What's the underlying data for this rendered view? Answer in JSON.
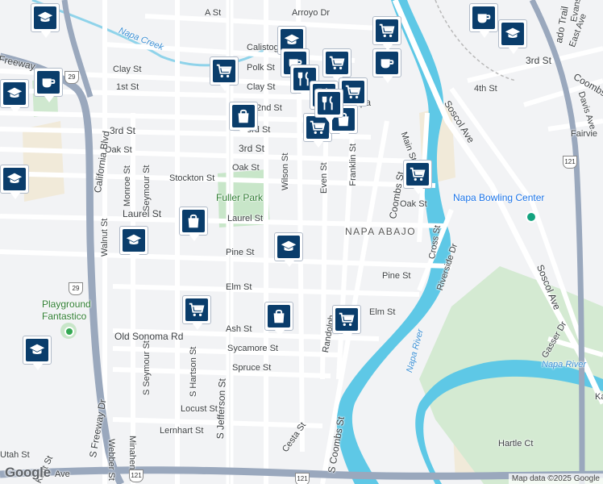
{
  "map": {
    "streets": {
      "arroyo": "Arroyo Dr",
      "a_st": "A St",
      "calistoga": "Calistoga",
      "clay_west": "Clay St",
      "clay_mid": "Clay St",
      "polk": "Polk St",
      "first": "1st St",
      "second": "2nd St",
      "third_west": "3rd St",
      "third_mid": "3rd St",
      "third_east": "3rd St",
      "oak_west": "Oak St",
      "oak_mid": "Oak St",
      "oak_east": "Oak St",
      "stockton": "Stockton St",
      "laurel_west": "Laurel St",
      "laurel_mid": "Laurel St",
      "pine_mid": "Pine St",
      "pine_east": "Pine St",
      "elm_mid": "Elm St",
      "elm_east": "Elm St",
      "ash": "Ash St",
      "sycamore": "Sycamore St",
      "spruce": "Spruce St",
      "locust": "Locust St",
      "lernhart": "Lernhart St",
      "old_sonoma": "Old Sonoma Rd",
      "main": "Main St",
      "franklin": "Franklin St",
      "wilson": "Wilson St",
      "even": "Even St",
      "coombs_north": "Coombs St",
      "coombs_south": "S Coombs St",
      "randolph": "Randolph",
      "california": "California Blvd",
      "monroe": "Monroe St",
      "seymour": "Seymour St",
      "walnut": "Walnut St",
      "s_seymour": "S Seymour St",
      "s_hartson": "S Hartson St",
      "s_jefferson": "S Jefferson St",
      "s_freeway": "S Freeway Dr",
      "freeway_nw": "Freeway",
      "minahen": "Minahen St",
      "webber": "Webber St",
      "utah": "Utah St",
      "kent": "Kent St",
      "cesta": "Cesta St",
      "ave_bottom": "Ave",
      "cross": "Cross St",
      "riverside": "Riverside Dr",
      "soscol_north": "Soscol Ave",
      "soscol_south": "Soscol Ave",
      "fourth": "4th St",
      "coombs_right": "Coombs",
      "davis": "Davis Ave",
      "fairview": "Fairvie",
      "east_ave": "East Ave",
      "evans": "Evans",
      "trail": "ado Trail",
      "gasser": "Gasser Dr",
      "hartle": "Hartle Ct",
      "ka": "Ka",
      "napa_top": "apa"
    },
    "areas": {
      "napa_abajo": "NAPA ABAJO"
    },
    "parks": {
      "fuller": "Fuller Park",
      "playground_line1": "Playground",
      "playground_line2": "Fantastico"
    },
    "water": {
      "napa_creek": "Napa Creek",
      "napa_river": "Napa River",
      "napa_river_east": "Napa River"
    },
    "pois": {
      "bowling": "Napa Bowling Center"
    },
    "highway_shields": {
      "h29_north": "29",
      "h29_south": "29",
      "h121_east": "121",
      "h121_bottom_left": "121",
      "h121_bottom_mid": "121"
    },
    "markers": [
      {
        "type": "school-icon"
      },
      {
        "type": "school-icon"
      },
      {
        "type": "school-icon"
      },
      {
        "type": "school-icon"
      },
      {
        "type": "school-icon"
      },
      {
        "type": "school-icon"
      },
      {
        "type": "school-icon"
      },
      {
        "type": "school-icon"
      },
      {
        "type": "cafe-icon"
      },
      {
        "type": "cafe-icon"
      },
      {
        "type": "cafe-icon"
      },
      {
        "type": "cafe-icon"
      },
      {
        "type": "shopping-cart-icon"
      },
      {
        "type": "shopping-cart-icon"
      },
      {
        "type": "shopping-cart-icon"
      },
      {
        "type": "shopping-cart-icon"
      },
      {
        "type": "shopping-cart-icon"
      },
      {
        "type": "shopping-cart-icon"
      },
      {
        "type": "shopping-cart-icon"
      },
      {
        "type": "shopping-cart-icon"
      },
      {
        "type": "shopping-bag-icon"
      },
      {
        "type": "shopping-bag-icon"
      },
      {
        "type": "shopping-bag-icon"
      },
      {
        "type": "shopping-bag-icon"
      },
      {
        "type": "restaurant-icon"
      },
      {
        "type": "restaurant-icon"
      },
      {
        "type": "restaurant-icon"
      }
    ],
    "footer": {
      "logo": "Google",
      "attribution": "Map data ©2025 Google"
    },
    "colors": {
      "marker_fill": "#0a3d6b",
      "river": "#5ec8e6",
      "park": "#c8e6c9",
      "highway": "#9aa8bd"
    }
  }
}
